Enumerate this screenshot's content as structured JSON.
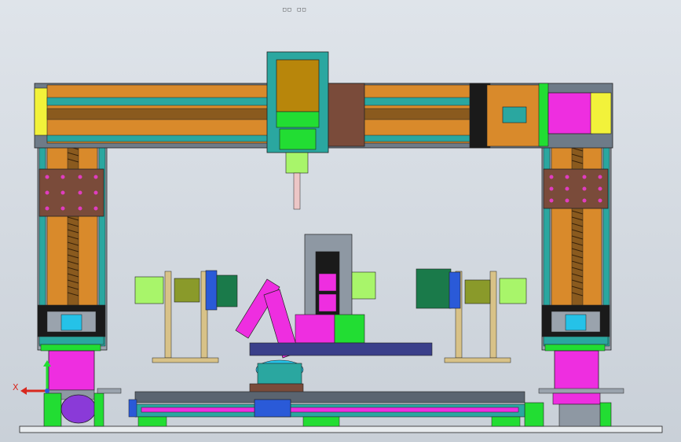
{
  "header": {
    "view_label": "□□  □□"
  },
  "triad": {
    "x_label": "X"
  },
  "colors": {
    "background": "#d6dce2",
    "frame_gray": "#8e98a3",
    "gantry_rail": "#6e7b88",
    "brass": "#b8860b",
    "orange": "#d98a2b",
    "teal": "#2aa7a0",
    "magenta": "#ee2ee0",
    "green": "#22dd33",
    "lime": "#a8f56a",
    "yellow": "#f2f23a",
    "brown_plate": "#7a4b3a",
    "blue": "#2a5ad8",
    "purple": "#8a3ad8",
    "cyan": "#25c2e8",
    "tan": "#d8c288"
  }
}
